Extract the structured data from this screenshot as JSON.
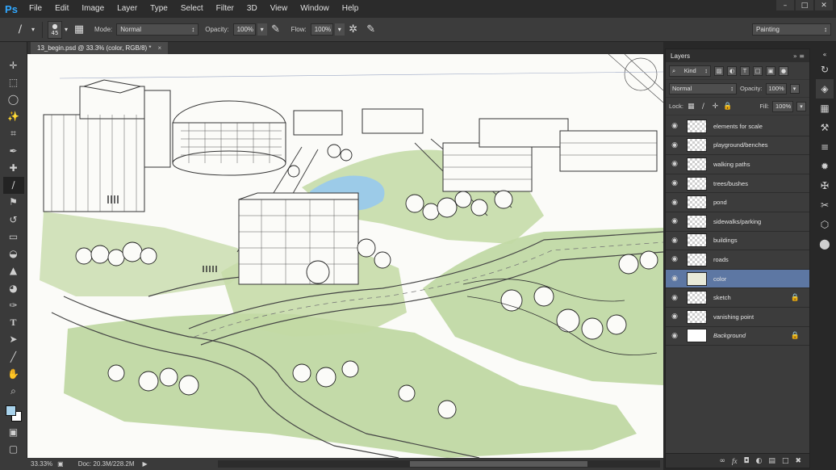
{
  "app": {
    "logo": "Ps"
  },
  "menu": [
    "File",
    "Edit",
    "Image",
    "Layer",
    "Type",
    "Select",
    "Filter",
    "3D",
    "View",
    "Window",
    "Help"
  ],
  "window_controls": {
    "minimize": "–",
    "restore": "□",
    "close": "✕"
  },
  "options": {
    "brush_size": "45",
    "mode_label": "Mode:",
    "mode_value": "Normal",
    "opacity_label": "Opacity:",
    "opacity_value": "100%",
    "flow_label": "Flow:",
    "flow_value": "100%",
    "workspace": "Painting"
  },
  "document": {
    "tab_title": "13_begin.psd @ 33.3% (color, RGB/8) *",
    "close": "×"
  },
  "status": {
    "zoom": "33.33%",
    "doc": "Doc: 20.3M/228.2M"
  },
  "layers_panel": {
    "tab": "Layers",
    "filter_kind": "Kind",
    "blend_mode": "Normal",
    "opacity_label": "Opacity:",
    "opacity_value": "100%",
    "lock_label": "Lock:",
    "fill_label": "Fill:",
    "fill_value": "100%",
    "layers": [
      {
        "name": "elements for scale",
        "selected": false,
        "locked": false,
        "thumb": "transparent"
      },
      {
        "name": "playground/benches",
        "selected": false,
        "locked": false,
        "thumb": "transparent"
      },
      {
        "name": "walking paths",
        "selected": false,
        "locked": false,
        "thumb": "transparent"
      },
      {
        "name": "trees/bushes",
        "selected": false,
        "locked": false,
        "thumb": "transparent"
      },
      {
        "name": "pond",
        "selected": false,
        "locked": false,
        "thumb": "transparent"
      },
      {
        "name": "sidewalks/parking",
        "selected": false,
        "locked": false,
        "thumb": "transparent"
      },
      {
        "name": "buildings",
        "selected": false,
        "locked": false,
        "thumb": "transparent"
      },
      {
        "name": "roads",
        "selected": false,
        "locked": false,
        "thumb": "transparent"
      },
      {
        "name": "color",
        "selected": true,
        "locked": false,
        "thumb": "color"
      },
      {
        "name": "sketch",
        "selected": false,
        "locked": true,
        "thumb": "transparent"
      },
      {
        "name": "vanishing point",
        "selected": false,
        "locked": false,
        "thumb": "transparent"
      },
      {
        "name": "Background",
        "selected": false,
        "locked": true,
        "thumb": "white",
        "italic": true
      }
    ]
  },
  "colors": {
    "foreground": "#a9d3ec",
    "background": "#ffffff",
    "selection": "#5d77a3",
    "grass": "#b9d39a",
    "pond": "#9ccbe8"
  }
}
